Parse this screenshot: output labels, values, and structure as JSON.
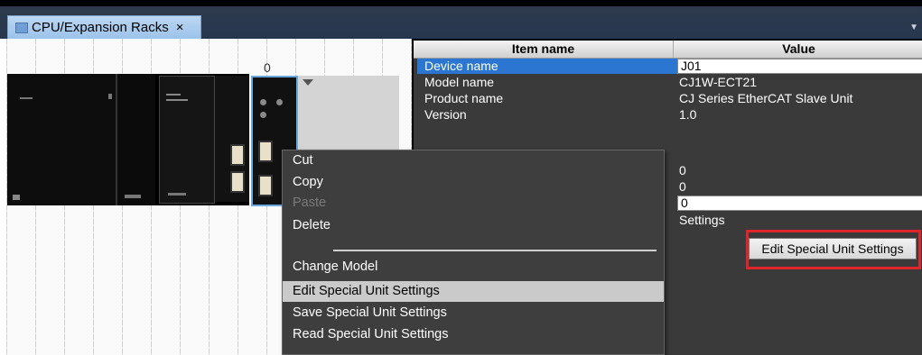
{
  "window": {
    "tab_label": "CPU/Expansion Racks",
    "tab_close": "×"
  },
  "rack": {
    "slot_number": "0"
  },
  "properties": {
    "header_item": "Item name",
    "header_value": "Value",
    "rows": [
      {
        "name": "Device name",
        "value": "J01"
      },
      {
        "name": "Model name",
        "value": "CJ1W-ECT21"
      },
      {
        "name": "Product name",
        "value": "CJ Series EtherCAT Slave Unit"
      },
      {
        "name": "Version",
        "value": "1.0"
      }
    ],
    "values_below": [
      "0",
      "0",
      "0"
    ],
    "settings_label": "Settings",
    "edit_button_label": "Edit Special Unit Settings"
  },
  "context_menu": {
    "items": [
      {
        "label": "Cut",
        "enabled": true
      },
      {
        "label": "Copy",
        "enabled": true
      },
      {
        "label": "Paste",
        "enabled": false
      },
      {
        "label": "Delete",
        "enabled": true
      },
      {
        "label": "Change Model",
        "enabled": true
      },
      {
        "label": "Edit Special Unit Settings",
        "enabled": true,
        "highlighted": true
      },
      {
        "label": "Save Special Unit Settings",
        "enabled": true
      },
      {
        "label": "Read Special Unit Settings",
        "enabled": true
      }
    ]
  },
  "colors": {
    "selection": "#2a76d0",
    "callout": "#e0242b",
    "panel_bg": "#3a3a3a"
  }
}
